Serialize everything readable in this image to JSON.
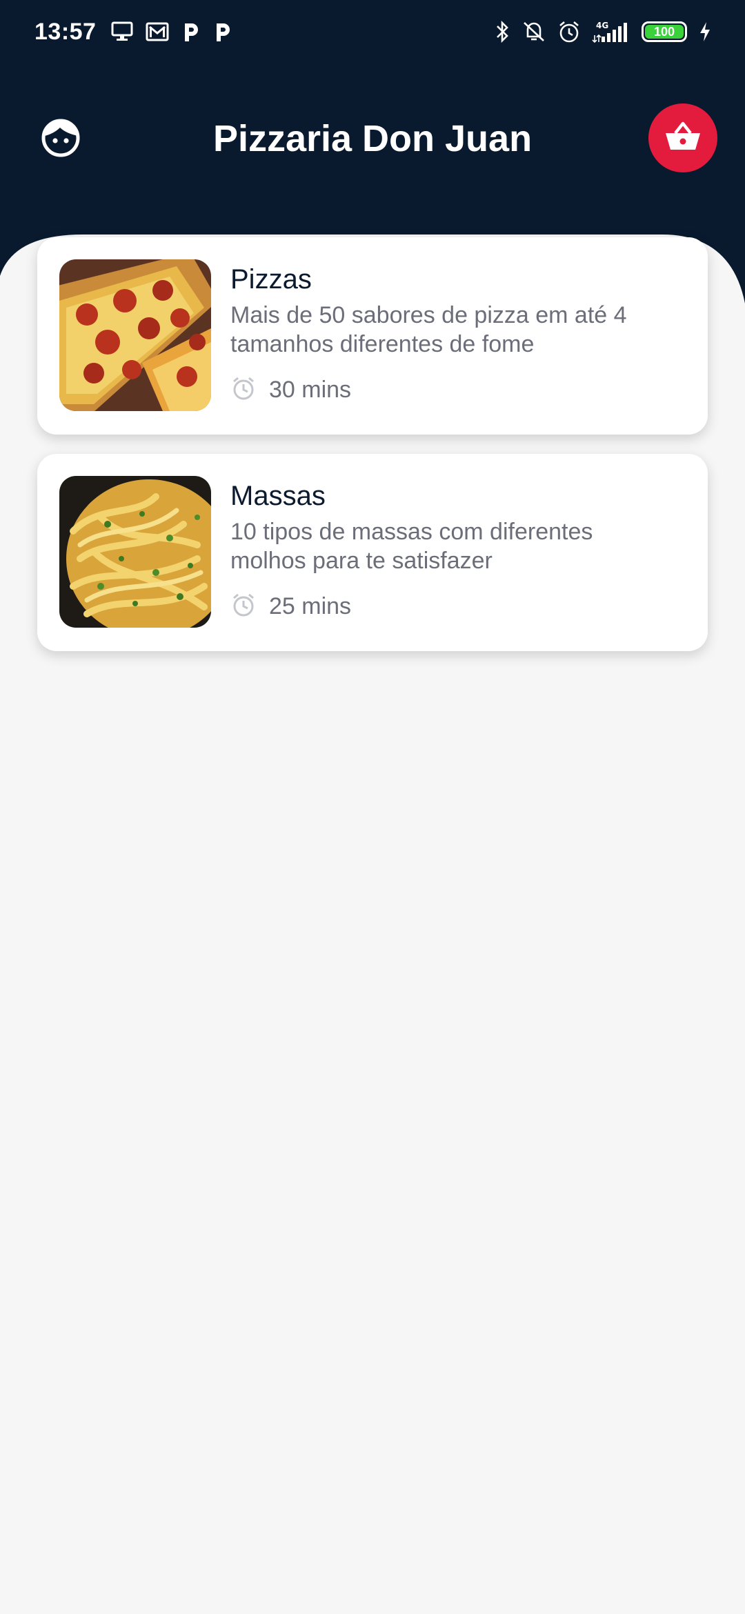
{
  "status_bar": {
    "time": "13:57",
    "left_icons": [
      "monitor-icon",
      "mail-icon",
      "p-app-icon",
      "p-app-icon"
    ],
    "right_icons": [
      "bluetooth-icon",
      "vibrate-off-icon",
      "alarm-icon",
      "signal-icon"
    ],
    "network": "4G",
    "battery": "100",
    "battery_color": "#3ad13a"
  },
  "header": {
    "title": "Pizzaria Don Juan",
    "background_color": "#0a1a2e",
    "cart_color": "#e31c3d",
    "profile_icon": "face-icon",
    "cart_icon": "basket-icon"
  },
  "categories": [
    {
      "title": "Pizzas",
      "description": "Mais de 50 sabores de pizza em até 4 tamanhos diferentes de fome",
      "time": "30 mins",
      "image": "pizza-image"
    },
    {
      "title": "Massas",
      "description": "10 tipos de massas com diferentes molhos para te satisfazer",
      "time": "25 mins",
      "image": "pasta-image"
    }
  ]
}
